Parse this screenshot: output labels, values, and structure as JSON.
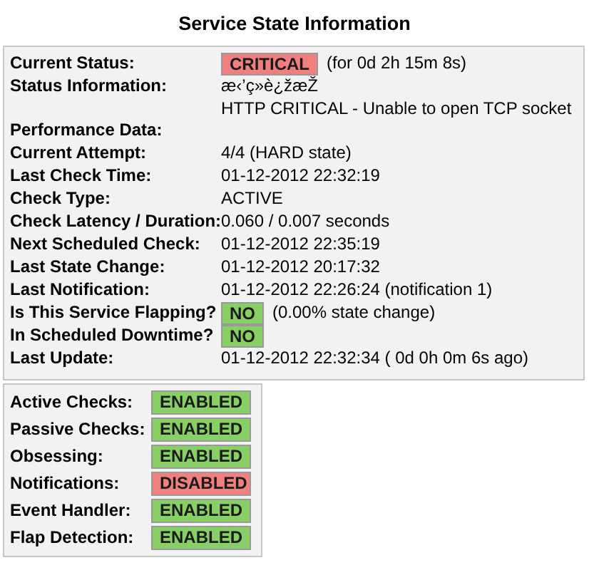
{
  "title": "Service State Information",
  "state_rows": [
    {
      "label": "Current Status:",
      "kind": "badge",
      "badge": {
        "text": "CRITICAL",
        "color": "#f08080"
      },
      "note": "(for 0d 2h 15m 8s)"
    },
    {
      "label": "Status Information:",
      "kind": "text",
      "lines": [
        "æ‹’ç»è¿žæŽ",
        "HTTP CRITICAL - Unable to open TCP socket"
      ]
    },
    {
      "label": "Performance Data:",
      "kind": "text",
      "lines": []
    },
    {
      "label": "Current Attempt:",
      "kind": "text",
      "lines": [
        "4/4  (HARD state)"
      ]
    },
    {
      "label": "Last Check Time:",
      "kind": "text",
      "lines": [
        "01-12-2012 22:32:19"
      ]
    },
    {
      "label": "Check Type:",
      "kind": "text",
      "lines": [
        "ACTIVE"
      ]
    },
    {
      "label": "Check Latency / Duration:",
      "kind": "text",
      "lines": [
        "0.060 / 0.007 seconds"
      ]
    },
    {
      "label": "Next Scheduled Check:",
      "kind": "text",
      "lines": [
        "01-12-2012 22:35:19"
      ]
    },
    {
      "label": "Last State Change:",
      "kind": "text",
      "lines": [
        "01-12-2012 20:17:32"
      ]
    },
    {
      "label": "Last Notification:",
      "kind": "text",
      "lines": [
        "01-12-2012 22:26:24 (notification 1)"
      ]
    },
    {
      "label": "Is This Service Flapping?",
      "kind": "badge",
      "badge": {
        "text": "NO",
        "color": "#88d066"
      },
      "note": "(0.00% state change)"
    },
    {
      "label": "In Scheduled Downtime?",
      "kind": "badge",
      "badge": {
        "text": "NO",
        "color": "#88d066"
      }
    },
    {
      "label": "Last Update:",
      "kind": "text",
      "lines": [
        "01-12-2012 22:32:34  ( 0d 0h 0m 6s ago)"
      ]
    }
  ],
  "feature_rows": [
    {
      "label": "Active Checks:",
      "badge": {
        "text": "ENABLED",
        "color": "#88d066"
      }
    },
    {
      "label": "Passive Checks:",
      "badge": {
        "text": "ENABLED",
        "color": "#88d066"
      }
    },
    {
      "label": "Obsessing:",
      "badge": {
        "text": "ENABLED",
        "color": "#88d066"
      }
    },
    {
      "label": "Notifications:",
      "badge": {
        "text": "DISABLED",
        "color": "#f08080"
      }
    },
    {
      "label": "Event Handler:",
      "badge": {
        "text": "ENABLED",
        "color": "#88d066"
      }
    },
    {
      "label": "Flap Detection:",
      "badge": {
        "text": "ENABLED",
        "color": "#88d066"
      }
    }
  ]
}
